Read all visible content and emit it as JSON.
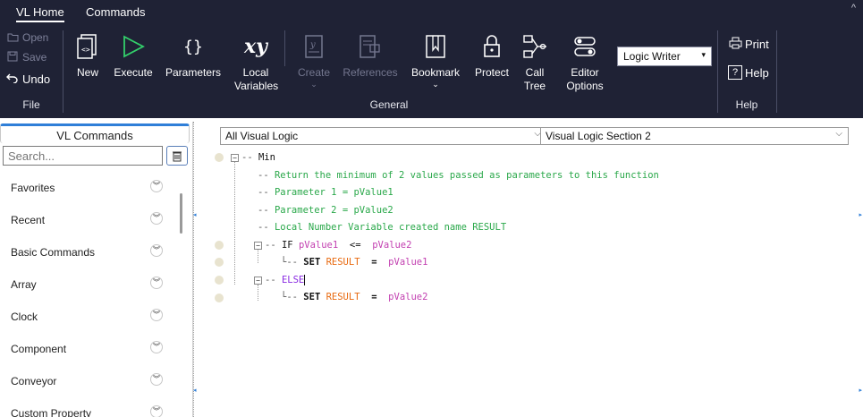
{
  "ribbon": {
    "tabs": [
      {
        "label": "VL Home"
      },
      {
        "label": "Commands"
      }
    ],
    "collapse_glyph": "^",
    "file_group": {
      "label": "File",
      "open": "Open",
      "save": "Save",
      "undo": "Undo"
    },
    "general_group": {
      "label": "General",
      "new": "New",
      "execute": "Execute",
      "parameters": "Parameters",
      "local_variables_1": "Local",
      "local_variables_2": "Variables",
      "create": "Create",
      "references": "References",
      "bookmark": "Bookmark",
      "protect": "Protect",
      "call_tree_1": "Call",
      "call_tree_2": "Tree",
      "editor_options_1": "Editor",
      "editor_options_2": "Options",
      "writer_mode": "Logic Writer"
    },
    "help_group": {
      "label": "Help",
      "print": "Print",
      "help": "Help"
    }
  },
  "left_panel": {
    "title": "VL Commands",
    "search_placeholder": "Search...",
    "items": [
      {
        "label": "Favorites"
      },
      {
        "label": "Recent"
      },
      {
        "label": "Basic Commands"
      },
      {
        "label": "Array"
      },
      {
        "label": "Clock"
      },
      {
        "label": "Component"
      },
      {
        "label": "Conveyor"
      },
      {
        "label": "Custom Property"
      }
    ]
  },
  "editor": {
    "scope": "All Visual Logic",
    "section": "Visual Logic Section 2",
    "lines": {
      "l0": "Min",
      "l1": "Return the minimum of 2 values passed as parameters to this function",
      "l2": "Parameter 1 = pValue1",
      "l3": "Parameter 2 = pValue2",
      "l4": "Local Number Variable created name RESULT",
      "if_kw": "IF",
      "if_a": "pValue1",
      "if_op": "<=",
      "if_b": "pValue2",
      "set_kw": "SET",
      "set_var": "RESULT",
      "set_eq": "=",
      "set_val1": "pValue1",
      "else_kw": "ELSE",
      "set_val2": "pValue2"
    }
  }
}
